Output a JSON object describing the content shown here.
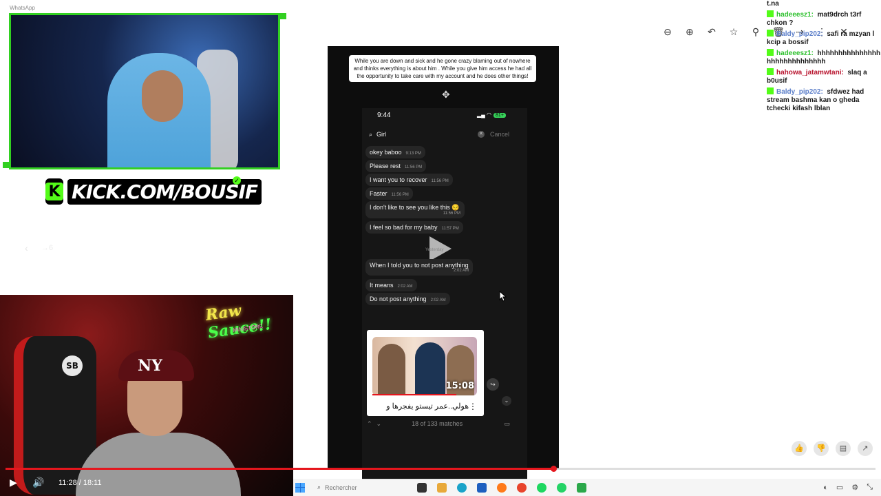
{
  "app": {
    "title": "WhatsApp"
  },
  "brand": {
    "url": "KICK.COM/BOUSIF",
    "logo_letter": "K",
    "accent": "#53fc18"
  },
  "cam_bottom": {
    "neon_line1": "Raw",
    "neon_line2": "Sauce!!",
    "neon_sub": "MINISTORE",
    "cap_logo": "NY",
    "badge": "SB"
  },
  "player": {
    "time": "11:28 / 18:11",
    "progress_fraction": 0.63
  },
  "phone": {
    "caption": "While you are down and sick and he gone crazy blaming out of nowhere and thinks everything is about him . While you give him access he had all the opportunity to take care with my account and he does other things!",
    "clock": "9:44",
    "battery": "81+",
    "search_query": "Girl",
    "search_cancel": "Cancel",
    "messages": [
      {
        "text": "okey baboo",
        "time": "9:13 PM"
      },
      {
        "text": "Please rest",
        "time": "11:56 PM"
      },
      {
        "text": "I want you to recover",
        "time": "11:56 PM"
      },
      {
        "text": "Faster",
        "time": "11:56 PM"
      },
      {
        "text": "I don't like to see you like this 😔",
        "time": "11:56 PM"
      },
      {
        "text": "I feel so bad for my baby",
        "time": "11:57 PM"
      },
      {
        "text": "When I told you to not post anything",
        "time": "2:02 AM"
      },
      {
        "text": "It means",
        "time": "2:02 AM"
      },
      {
        "text": "Do not post anything",
        "time": "2:02 AM"
      }
    ],
    "yesterday_label": "Yesterday",
    "video_card": {
      "duration": "15:08",
      "title": "هولي..عمر تيستو يفجرها و"
    },
    "matches": "18 of 133 matches"
  },
  "chat": [
    {
      "user": "",
      "message": "t.na",
      "color": "",
      "badge": false
    },
    {
      "user": "hadeeesz1:",
      "message": "mat9drch t3rf chkon ?",
      "color": "green",
      "badge": true
    },
    {
      "user": "Baldy_pip202:",
      "message": "safi ra mzyan l kcip a bossif",
      "color": "blue",
      "badge": true
    },
    {
      "user": "hadeeesz1:",
      "message": "hhhhhhhhhhhhhhhhhhhhhhhhhhhhh",
      "color": "green",
      "badge": true
    },
    {
      "user": "hahowa_jatamwtani:",
      "message": "slaq a b0usif",
      "color": "red",
      "badge": true
    },
    {
      "user": "Baldy_pip202:",
      "message": "sfdwez had stream bashma kan o gheda tchecki kifash lblan",
      "color": "blue",
      "badge": true
    }
  ],
  "taskbar": {
    "search_placeholder": "Rechercher"
  },
  "overlay": {
    "page_hint": "→6"
  }
}
